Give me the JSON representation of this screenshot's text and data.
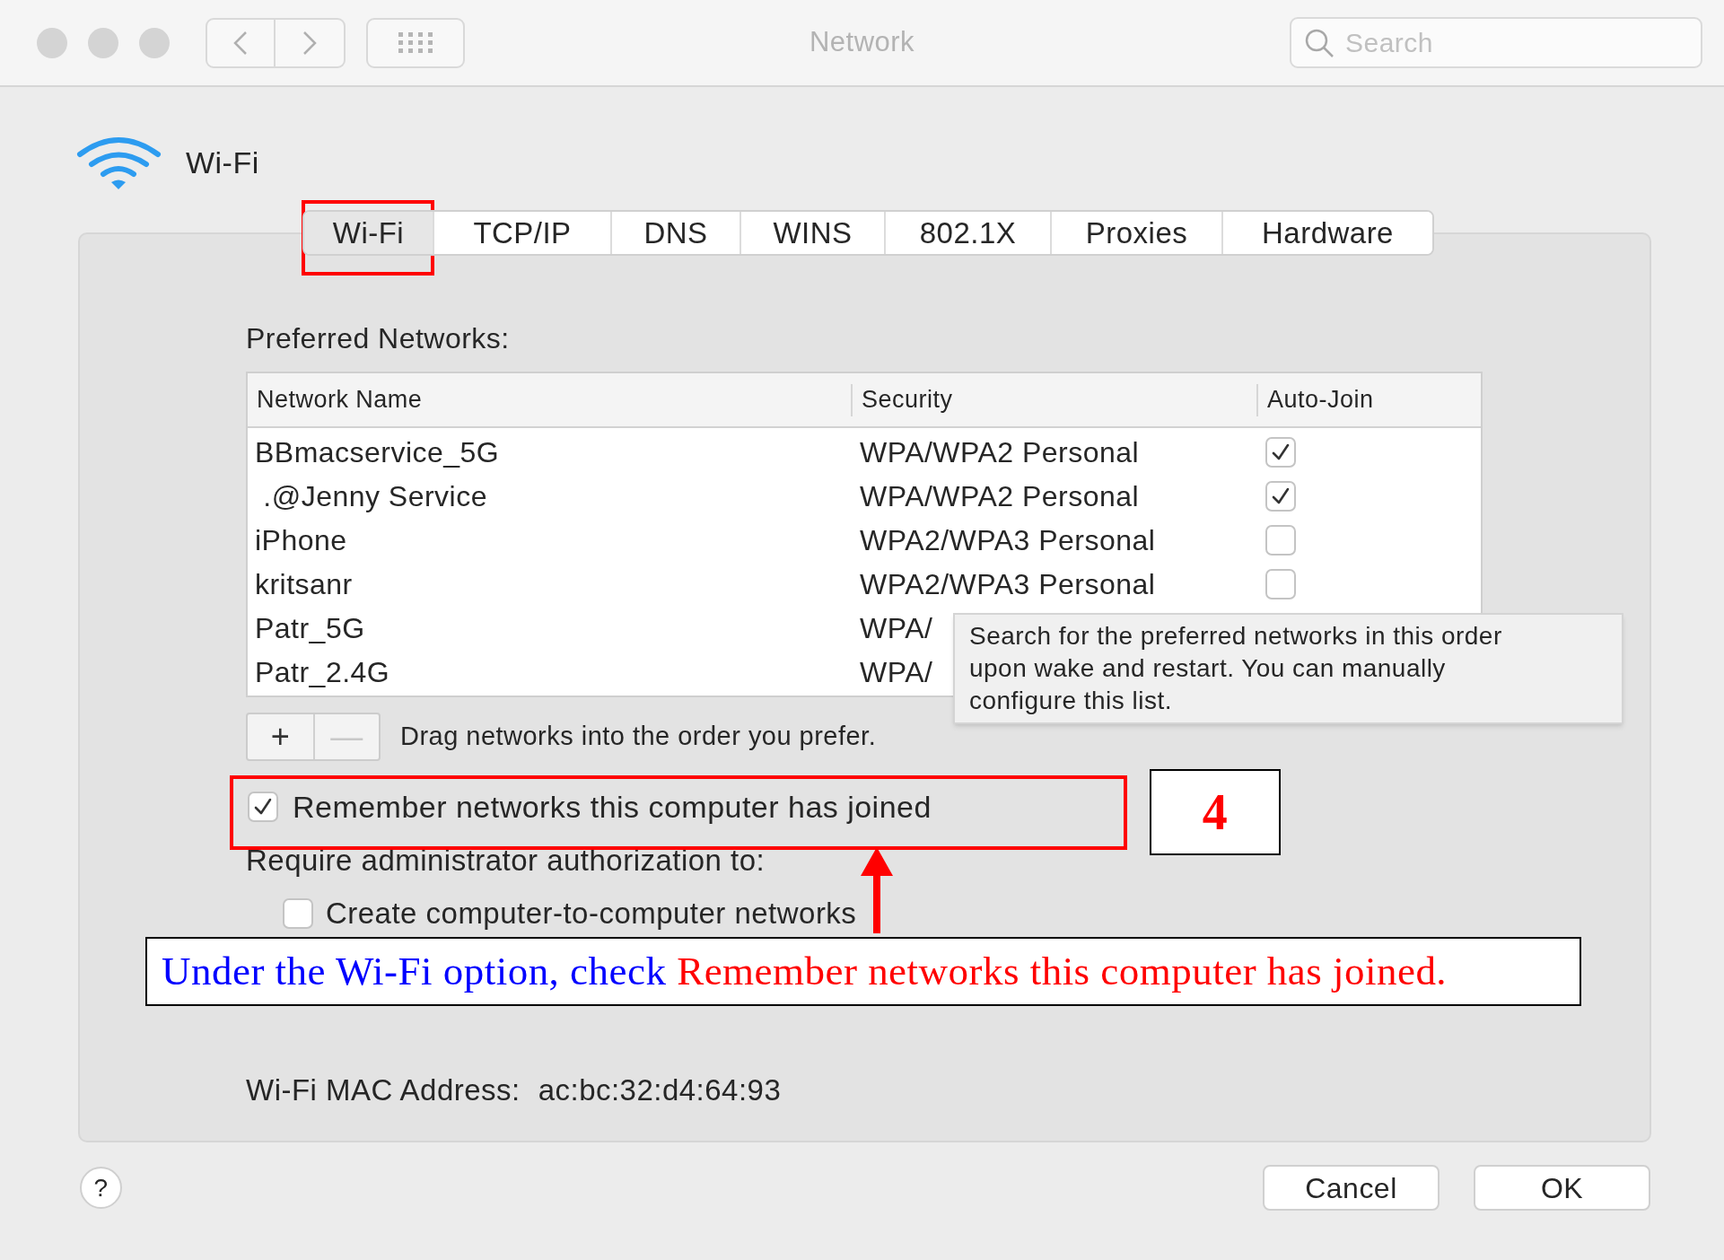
{
  "window": {
    "title": "Network",
    "search": {
      "placeholder": "Search"
    }
  },
  "header": {
    "title": "Wi-Fi"
  },
  "tabs": [
    {
      "label": "Wi-Fi",
      "selected": true
    },
    {
      "label": "TCP/IP",
      "selected": false
    },
    {
      "label": "DNS",
      "selected": false
    },
    {
      "label": "WINS",
      "selected": false
    },
    {
      "label": "802.1X",
      "selected": false
    },
    {
      "label": "Proxies",
      "selected": false
    },
    {
      "label": "Hardware",
      "selected": false
    }
  ],
  "preferred_networks": {
    "label": "Preferred Networks:",
    "columns": [
      "Network Name",
      "Security",
      "Auto-Join"
    ],
    "rows": [
      {
        "name": "BBmacservice_5G",
        "security": "WPA/WPA2 Personal",
        "auto_join": true
      },
      {
        "name": " .@Jenny Service",
        "security": "WPA/WPA2 Personal",
        "auto_join": true
      },
      {
        "name": "iPhone",
        "security": "WPA2/WPA3 Personal",
        "auto_join": false
      },
      {
        "name": "kritsanr",
        "security": "WPA2/WPA3 Personal",
        "auto_join": false
      },
      {
        "name": "Patr_5G",
        "security": "WPA/"
      },
      {
        "name": "Patr_2.4G",
        "security": "WPA/"
      }
    ],
    "tooltip": "Search for the preferred networks in this order upon wake and restart. You can manually configure this list.",
    "list_buttons": [
      {
        "label": "+",
        "disabled": false
      },
      {
        "label": "—",
        "disabled": true
      }
    ],
    "hint": "Drag networks into the order you prefer."
  },
  "remember": {
    "label": "Remember networks this computer has joined",
    "checked": true
  },
  "require_label": "Require administrator authorization to:",
  "admin_options": [
    {
      "label": "Create computer-to-computer networks",
      "checked": false
    }
  ],
  "mac": {
    "label": "Wi-Fi MAC Address:",
    "value": "ac:bc:32:d4:64:93"
  },
  "help": "?",
  "buttons": [
    "Cancel",
    "OK"
  ],
  "annotation": {
    "step": "4",
    "caption_lead": "Under the Wi-Fi option, check",
    "caption_highlight": "Remember networks this computer has joined."
  }
}
